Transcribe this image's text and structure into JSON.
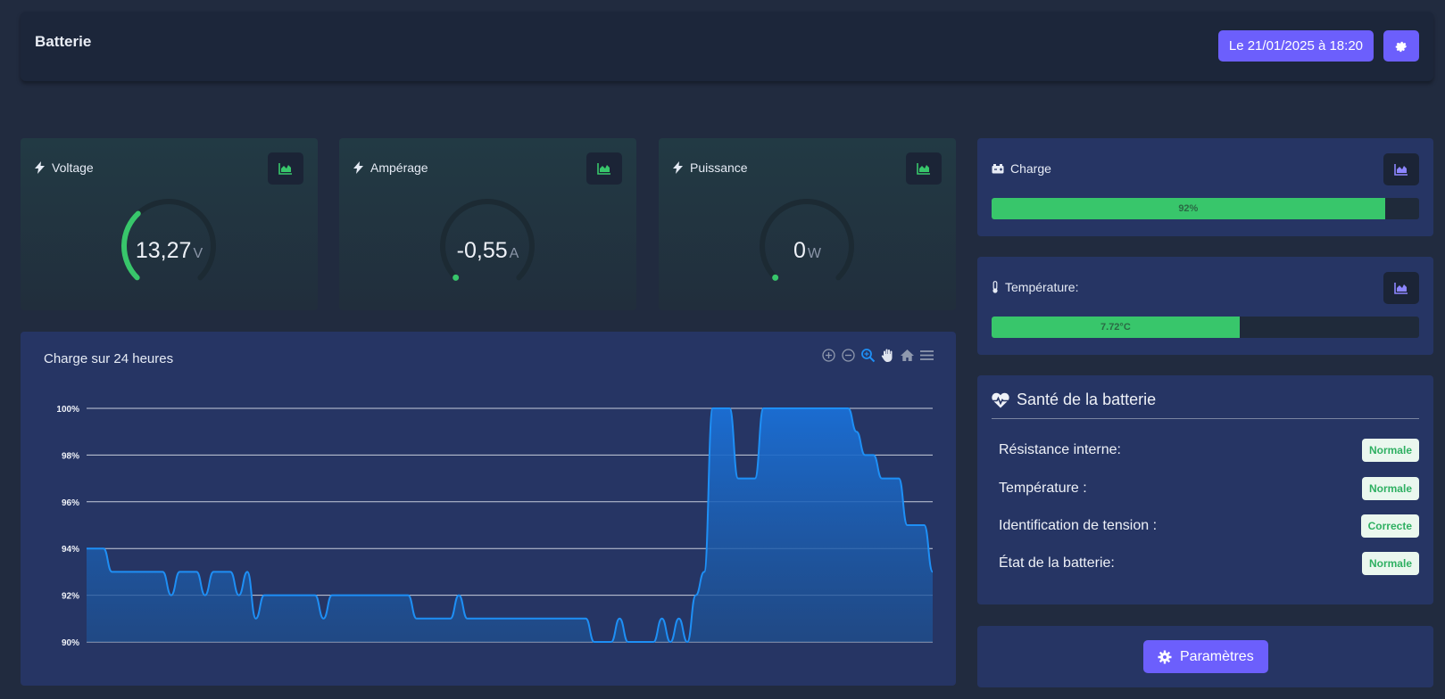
{
  "header": {
    "title": "Batterie",
    "date_label": "Le 21/01/2025 à 18:20"
  },
  "gauges": [
    {
      "label": "Voltage",
      "value": "13,27",
      "unit": "V",
      "level": 0.34
    },
    {
      "label": "Ampérage",
      "value": "-0,55",
      "unit": "A",
      "level": 0.0
    },
    {
      "label": "Puissance",
      "value": "0",
      "unit": "W",
      "level": 0.0
    }
  ],
  "charge_card": {
    "label": "Charge",
    "percent_text": "92%",
    "level": 0.92
  },
  "temperature_card": {
    "label": "Température:",
    "value_text": "7.72°C",
    "level": 0.58
  },
  "health": {
    "title": "Santé de la batterie",
    "rows": [
      {
        "label": "Résistance interne:",
        "status": "Normale"
      },
      {
        "label": "Température :",
        "status": "Normale"
      },
      {
        "label": "Identification de tension :",
        "status": "Correcte"
      },
      {
        "label": "État de la batterie:",
        "status": "Normale"
      }
    ]
  },
  "settings_button": {
    "label": "Paramètres"
  },
  "colors": {
    "accent": "#6c5ffc",
    "good": "#38c66b",
    "chart_line": "#1e8ff5"
  },
  "chart_data": {
    "type": "area",
    "title": "Charge sur 24 heures",
    "xlabel": "",
    "ylabel": "",
    "ylim": [
      90,
      100
    ],
    "yticks": [
      "100%",
      "98%",
      "96%",
      "94%",
      "92%",
      "90%"
    ],
    "grid": true,
    "x": [
      0,
      2,
      3,
      4,
      5,
      6,
      7,
      8,
      9,
      10,
      11,
      12,
      13,
      14,
      15,
      16,
      17,
      18,
      19,
      20,
      21,
      22,
      23,
      24,
      25,
      26,
      27,
      28,
      29,
      30,
      31,
      32,
      33,
      34,
      35,
      36,
      37,
      38,
      39,
      40,
      41,
      42,
      43,
      44,
      45,
      46,
      47,
      48,
      49,
      50,
      51,
      52,
      53,
      54,
      55,
      56,
      57,
      58,
      59,
      60,
      61,
      62,
      63,
      64,
      65,
      66,
      67,
      68,
      69,
      70,
      71,
      72,
      73,
      74,
      75,
      76,
      77,
      78,
      79,
      80,
      81,
      82,
      83,
      84,
      85,
      86,
      87,
      88,
      89,
      90,
      91,
      92,
      93,
      94,
      95,
      96,
      97,
      98,
      99,
      100
    ],
    "values": [
      94,
      94,
      93,
      93,
      93,
      93,
      93,
      93,
      93,
      92,
      93,
      93,
      93,
      92,
      93,
      93,
      93,
      92,
      93,
      91,
      92,
      92,
      92,
      92,
      92,
      92,
      92,
      91,
      92,
      92,
      92,
      92,
      92,
      92,
      92,
      92,
      92,
      92,
      91,
      91,
      91,
      91,
      91,
      92,
      91,
      91,
      91,
      91,
      91,
      91,
      91,
      91,
      91,
      91,
      91,
      91,
      91,
      91,
      91,
      90,
      90,
      90,
      91,
      90,
      90,
      90,
      90,
      91,
      90,
      91,
      90,
      92,
      93,
      100,
      100,
      100,
      97,
      97,
      97,
      100,
      100,
      100,
      100,
      100,
      100,
      100,
      100,
      100,
      100,
      100,
      99,
      98,
      98,
      97,
      97,
      97,
      95,
      95,
      95,
      93,
      92
    ],
    "toolbar_icons": [
      "zoom-in-icon",
      "zoom-out-icon",
      "selection-zoom-icon",
      "pan-hand-icon",
      "home-reset-icon",
      "menu-icon"
    ]
  }
}
